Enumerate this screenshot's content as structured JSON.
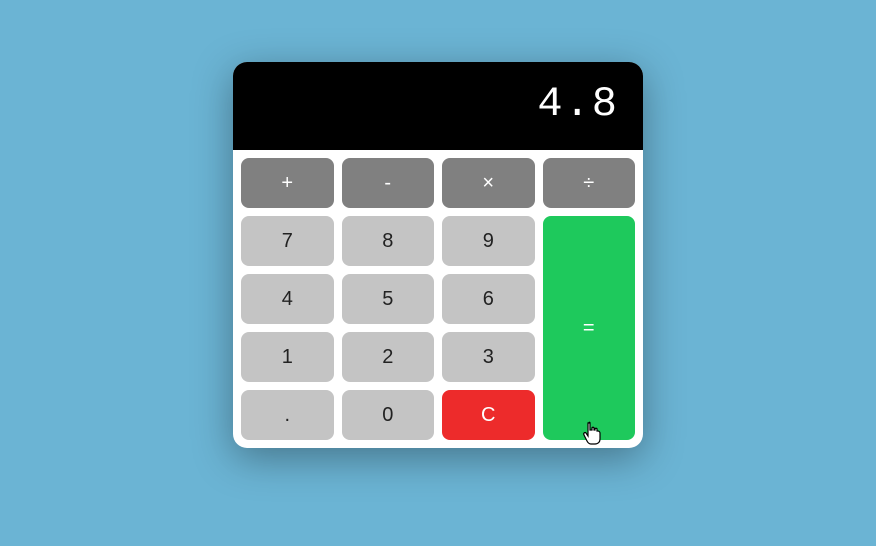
{
  "display": "4.8",
  "operators": {
    "add": "+",
    "subtract": "-",
    "multiply": "×",
    "divide": "÷"
  },
  "digits": {
    "d7": "7",
    "d8": "8",
    "d9": "9",
    "d4": "4",
    "d5": "5",
    "d6": "6",
    "d1": "1",
    "d2": "2",
    "d3": "3",
    "dot": ".",
    "d0": "0"
  },
  "clear": "C",
  "equals": "="
}
